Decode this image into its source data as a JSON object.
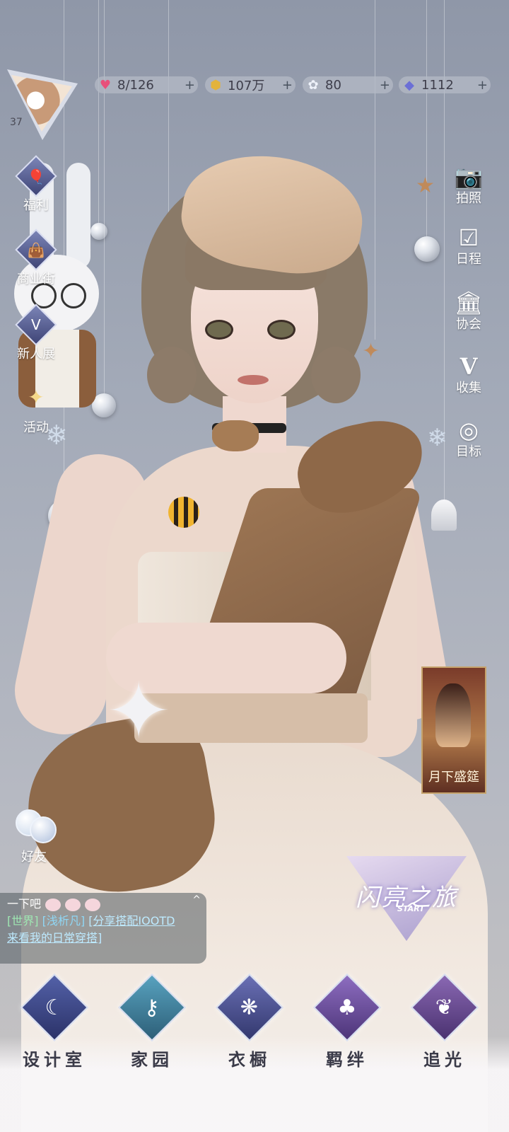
{
  "player": {
    "level": "37",
    "avatar_icon": "cat-avatar-icon"
  },
  "resources": [
    {
      "icon": "heart-icon",
      "value": "8/126",
      "color": "#e8507a"
    },
    {
      "icon": "gold-coin-icon",
      "value": "107万",
      "color": "#e3b33c"
    },
    {
      "icon": "crystal-flower-icon",
      "value": "80",
      "color": "#dfe6f5"
    },
    {
      "icon": "diamond-icon",
      "value": "1112",
      "color": "#6b6fd6"
    }
  ],
  "left_menu": [
    {
      "label": "福利",
      "icon": "hot-air-balloon-icon"
    },
    {
      "label": "商业街",
      "icon": "shopping-bag-icon"
    },
    {
      "label": "新人展",
      "icon": "trophy-v-icon"
    },
    {
      "label": "活动",
      "icon": "sparkle-star-icon"
    }
  ],
  "right_menu": [
    {
      "label": "拍照",
      "icon": "camera-icon"
    },
    {
      "label": "日程",
      "icon": "calendar-check-icon"
    },
    {
      "label": "协会",
      "icon": "guild-building-icon"
    },
    {
      "label": "收集",
      "icon": "collection-v-icon"
    },
    {
      "label": "目标",
      "icon": "target-medal-icon"
    }
  ],
  "event_card": {
    "label": "月下盛筵"
  },
  "friends": {
    "label": "好友"
  },
  "chat": {
    "line1": "一下吧",
    "channel": "[世界]",
    "user": "[浅析凡]",
    "message_link": "[分享搭配IOOTD",
    "message_cont": "来看我的日常穿搭]"
  },
  "journey": {
    "title": "闪亮之旅",
    "subtitle": "START"
  },
  "bottom_nav": [
    {
      "label": "设计室",
      "icon": "moon-needle-icon",
      "color": "#3e4a8a"
    },
    {
      "label": "家园",
      "icon": "key-icon",
      "color": "#3f7f9a"
    },
    {
      "label": "衣橱",
      "icon": "gem-flower-icon",
      "color": "#4a4f8e"
    },
    {
      "label": "羁绊",
      "icon": "clover-icon",
      "color": "#6b4f9a"
    },
    {
      "label": "追光",
      "icon": "butterfly-icon",
      "color": "#6a4b8d"
    }
  ]
}
